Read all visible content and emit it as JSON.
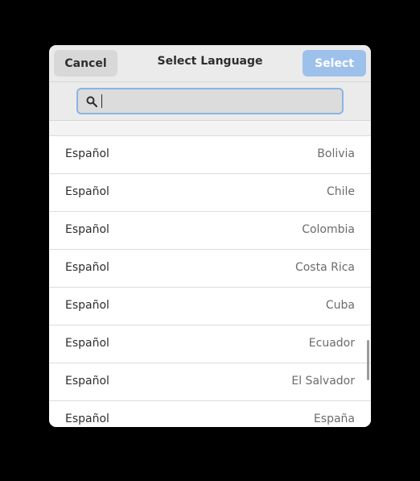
{
  "header": {
    "cancel_label": "Cancel",
    "title": "Select Language",
    "select_label": "Select"
  },
  "search": {
    "placeholder": "",
    "value": ""
  },
  "list": {
    "rows": [
      {
        "language": "Español",
        "region": "Bolivia"
      },
      {
        "language": "Español",
        "region": "Chile"
      },
      {
        "language": "Español",
        "region": "Colombia"
      },
      {
        "language": "Español",
        "region": "Costa Rica"
      },
      {
        "language": "Español",
        "region": "Cuba"
      },
      {
        "language": "Español",
        "region": "Ecuador"
      },
      {
        "language": "Español",
        "region": "El Salvador"
      },
      {
        "language": "Español",
        "region": "España"
      }
    ]
  },
  "colors": {
    "accent": "#9ec1ec",
    "focus_border": "#8bb4e4",
    "headerbar_bg": "#ebebeb"
  },
  "icons": {
    "search": "search-icon"
  }
}
